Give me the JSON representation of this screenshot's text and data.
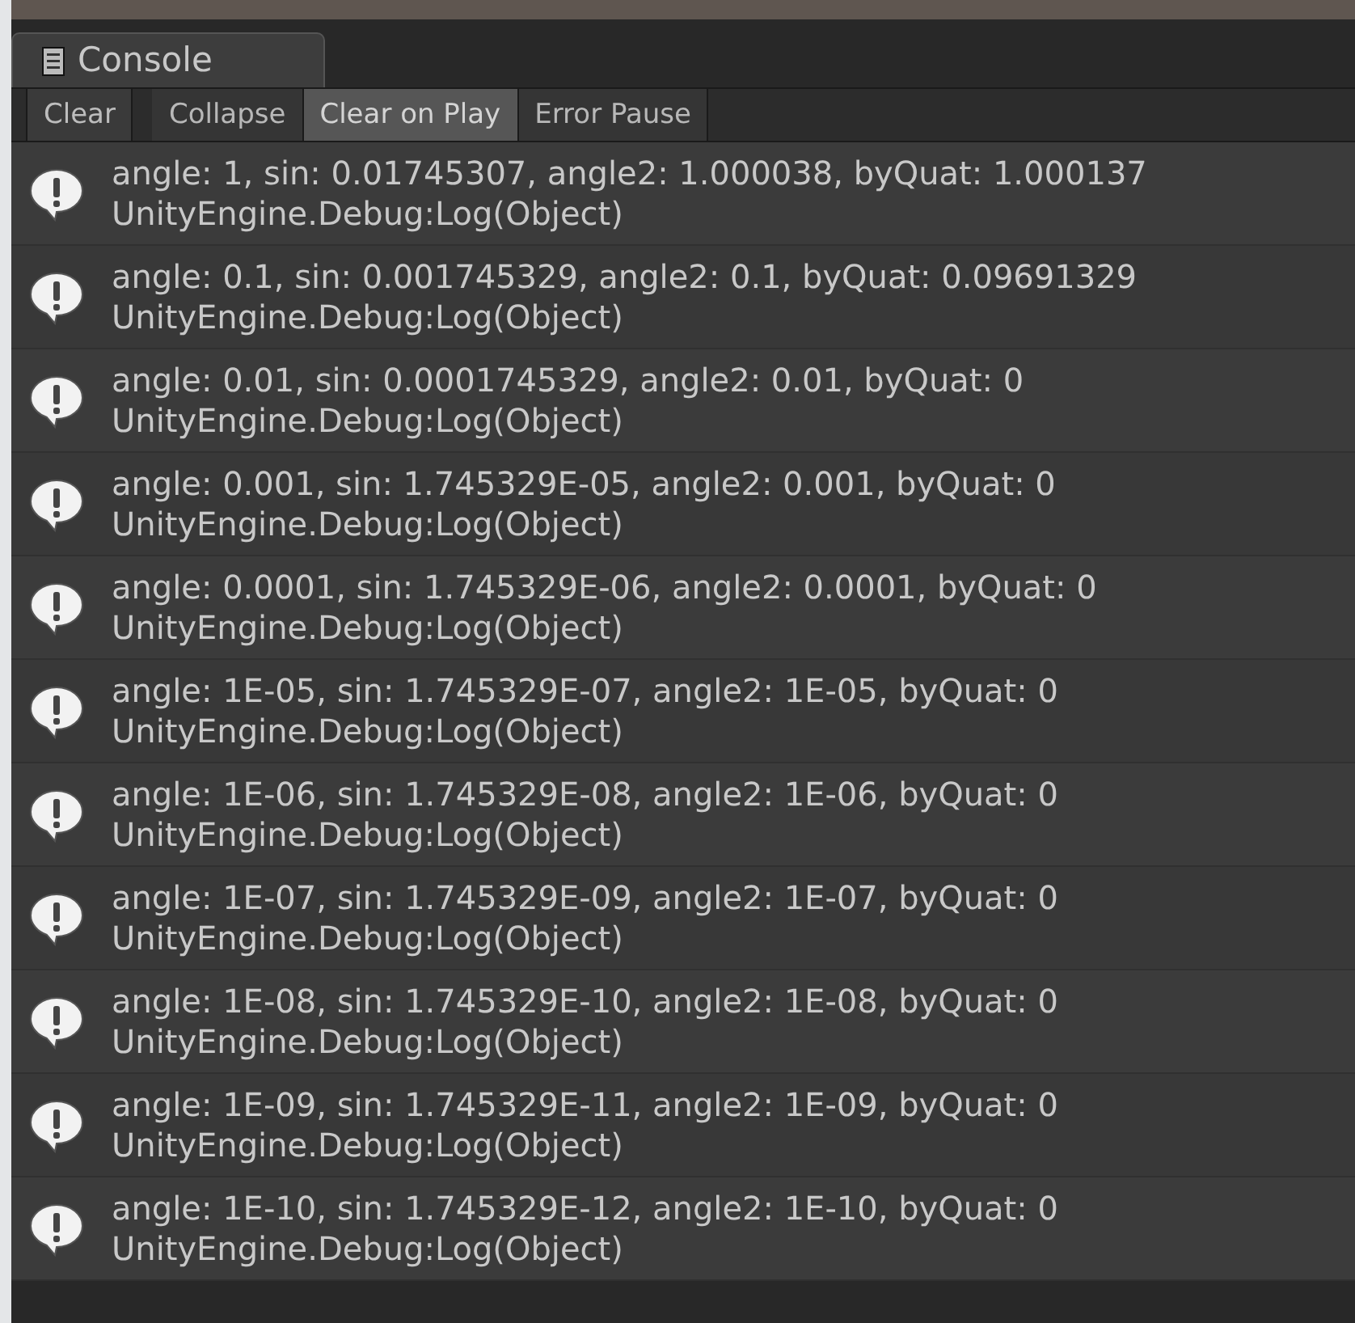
{
  "tab": {
    "title": "Console"
  },
  "toolbar": [
    {
      "label": "Clear",
      "kind": "button"
    },
    {
      "label": "Collapse",
      "kind": "toggle",
      "selected": false
    },
    {
      "label": "Clear on Play",
      "kind": "toggle",
      "selected": true
    },
    {
      "label": "Error Pause",
      "kind": "toggle",
      "selected": false
    }
  ],
  "entries": [
    {
      "message": "angle: 1, sin: 0.01745307, angle2: 1.000038, byQuat: 1.000137",
      "trace": "UnityEngine.Debug:Log(Object)"
    },
    {
      "message": "angle: 0.1, sin: 0.001745329, angle2: 0.1, byQuat: 0.09691329",
      "trace": "UnityEngine.Debug:Log(Object)"
    },
    {
      "message": "angle: 0.01, sin: 0.0001745329, angle2: 0.01, byQuat: 0",
      "trace": "UnityEngine.Debug:Log(Object)"
    },
    {
      "message": "angle: 0.001, sin: 1.745329E-05, angle2: 0.001, byQuat: 0",
      "trace": "UnityEngine.Debug:Log(Object)"
    },
    {
      "message": "angle: 0.0001, sin: 1.745329E-06, angle2: 0.0001, byQuat: 0",
      "trace": "UnityEngine.Debug:Log(Object)"
    },
    {
      "message": "angle: 1E-05, sin: 1.745329E-07, angle2: 1E-05, byQuat: 0",
      "trace": "UnityEngine.Debug:Log(Object)"
    },
    {
      "message": "angle: 1E-06, sin: 1.745329E-08, angle2: 1E-06, byQuat: 0",
      "trace": "UnityEngine.Debug:Log(Object)"
    },
    {
      "message": "angle: 1E-07, sin: 1.745329E-09, angle2: 1E-07, byQuat: 0",
      "trace": "UnityEngine.Debug:Log(Object)"
    },
    {
      "message": "angle: 1E-08, sin: 1.745329E-10, angle2: 1E-08, byQuat: 0",
      "trace": "UnityEngine.Debug:Log(Object)"
    },
    {
      "message": "angle: 1E-09, sin: 1.745329E-11, angle2: 1E-09, byQuat: 0",
      "trace": "UnityEngine.Debug:Log(Object)"
    },
    {
      "message": "angle: 1E-10, sin: 1.745329E-12, angle2: 1E-10, byQuat: 0",
      "trace": "UnityEngine.Debug:Log(Object)"
    }
  ]
}
